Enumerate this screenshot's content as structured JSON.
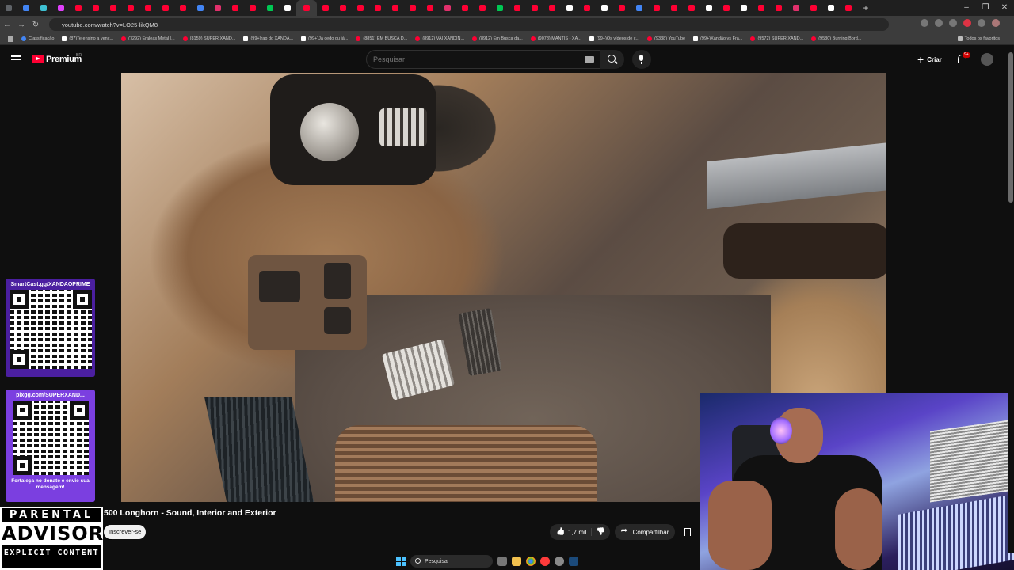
{
  "browser": {
    "url": "youtube.com/watch?v=LO25-likQM8",
    "window_controls": [
      "–",
      "❐",
      "✕"
    ],
    "tab_colors": [
      "#5f6368",
      "#4285f4",
      "#3ec1d3",
      "#e040fb",
      "#ff0033",
      "#ff0033",
      "#ff0033",
      "#ff0033",
      "#ff0033",
      "#ff0033",
      "#ff0033",
      "#4285f4",
      "#e1306c",
      "#ff0033",
      "#ff0033",
      "#00c853",
      "#ffffff",
      "#ff0033",
      "#ff0033",
      "#ff0033",
      "#ff0033",
      "#ff0033",
      "#ff0033",
      "#ff0033",
      "#ff0033",
      "#e1306c",
      "#ff0033",
      "#ff0033",
      "#00c853",
      "#ff0033",
      "#ff0033",
      "#ff0033",
      "#ffffff",
      "#ff0033",
      "#ffffff",
      "#ff0033",
      "#4285f4",
      "#ff0033",
      "#ff0033",
      "#ff0033",
      "#ffffff",
      "#ff0033",
      "#ffffff",
      "#ff0033",
      "#ff0033",
      "#e1306c",
      "#ff0033",
      "#ffffff",
      "#ff0033"
    ],
    "active_tab_index": 17,
    "bookmarks": [
      {
        "label": "Classificação",
        "icon": "globe-icon"
      },
      {
        "label": "(87)Te ensino a venc...",
        "icon": "tiktok-icon"
      },
      {
        "label": "(7292) Eraleas Metal |...",
        "icon": "youtube-icon"
      },
      {
        "label": "(8159) SUPER XAND...",
        "icon": "youtube-icon"
      },
      {
        "label": "(99+)rap do XANDÃ...",
        "icon": "tiktok-icon"
      },
      {
        "label": "(99+)Já cedo ou já...",
        "icon": "tiktok-icon"
      },
      {
        "label": "(8851) EM BUSCA D...",
        "icon": "youtube-icon"
      },
      {
        "label": "(8912) VAI XANDIN...",
        "icon": "youtube-icon"
      },
      {
        "label": "(8912) Em Busca da...",
        "icon": "youtube-icon"
      },
      {
        "label": "(9078) MANTIS - XA...",
        "icon": "youtube-icon"
      },
      {
        "label": "(99+)Os vídeos de c...",
        "icon": "tiktok-icon"
      },
      {
        "label": "(9338) YouTube",
        "icon": "youtube-icon"
      },
      {
        "label": "(99+)Xandão vs Fra...",
        "icon": "tiktok-icon"
      },
      {
        "label": "(9572) SUPER XAND...",
        "icon": "youtube-icon"
      },
      {
        "label": "(9580) Burning Bord...",
        "icon": "youtube-icon"
      }
    ],
    "bookmarks_folder": "Todos os favoritos"
  },
  "youtube": {
    "brand": "Premium",
    "region": "BR",
    "search_placeholder": "Pesquisar",
    "create_label": "Criar",
    "notifications_badge": "9+",
    "video_title": "500 Longhorn - Sound, Interior and Exterior",
    "subscribe_label": "Inscrever-se",
    "like_count": "1,7 mil",
    "share_label": "Compartilhar"
  },
  "overlay": {
    "qr1_title": "SmartCast.gg/XANDAOPRIME",
    "qr2_title": "pixgg.com/SUPERXAND...",
    "qr2_caption": "Fortaleça no donate e envie sua mensagem!",
    "advisory_top": "PARENTAL",
    "advisory_mid": "ADVISORY",
    "advisory_bot": "EXPLICIT CONTENT"
  },
  "taskbar": {
    "search_label": "Pesquisar",
    "apps": [
      "file-explorer-icon",
      "folder-icon",
      "chrome-icon",
      "obs-icon",
      "settings-icon",
      "steam-icon"
    ]
  },
  "colors": {
    "accent": "#ff0033",
    "background": "#0f0f0f",
    "qr_panel_purple": "#6a2bd6"
  }
}
